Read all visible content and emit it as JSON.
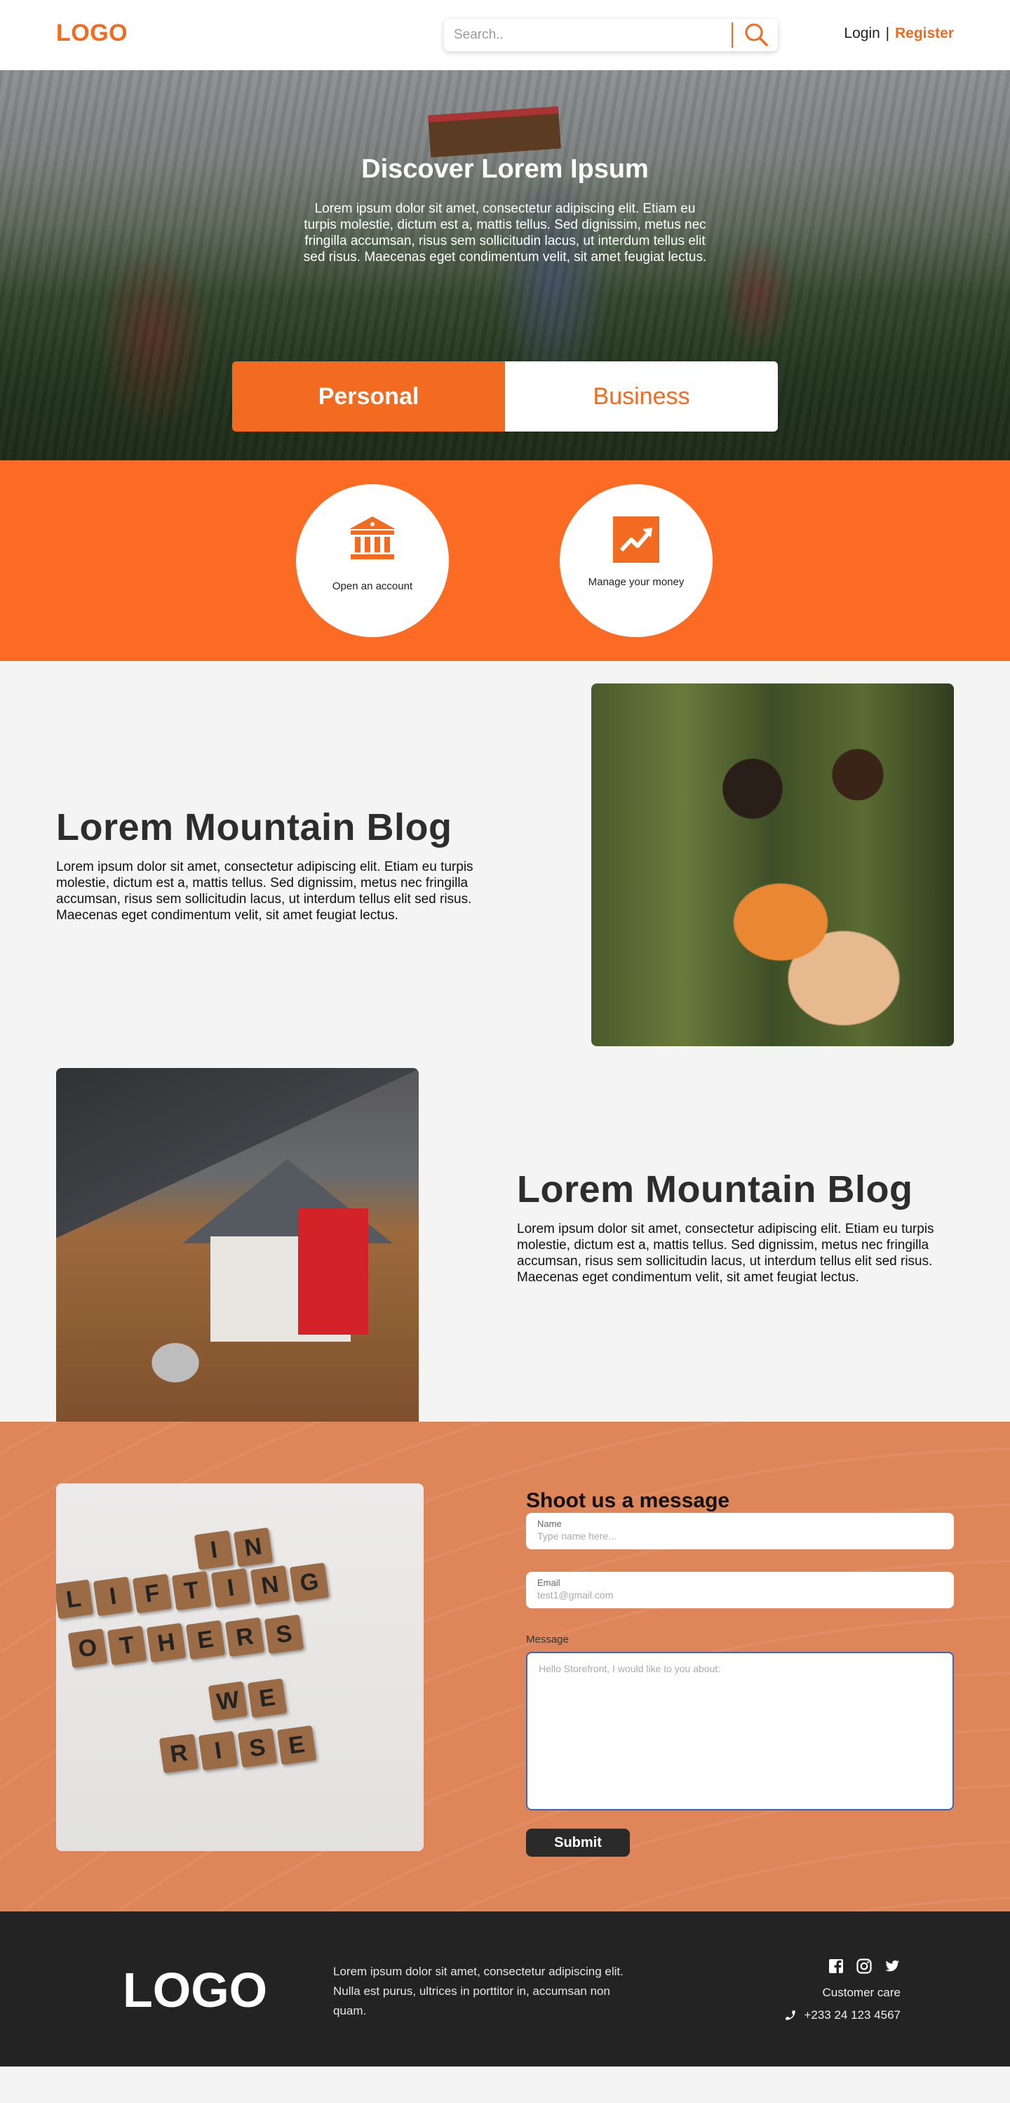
{
  "header": {
    "logo": "LOGO",
    "search_placeholder": "Search..",
    "login": "Login",
    "separator": "|",
    "register": "Register"
  },
  "hero": {
    "title": "Discover Lorem Ipsum",
    "text": "Lorem ipsum dolor sit amet, consectetur adipiscing elit. Etiam eu turpis molestie, dictum est a, mattis tellus. Sed dignissim, metus nec fringilla accumsan, risus sem sollicitudin lacus, ut interdum tellus elit sed risus. Maecenas eget condimentum velit, sit amet feugiat lectus.",
    "tabs": [
      {
        "label": "Personal",
        "active": true
      },
      {
        "label": "Business",
        "active": false
      }
    ]
  },
  "services": [
    {
      "icon": "bank-icon",
      "label": "Open an account"
    },
    {
      "icon": "trending-up-icon",
      "label": "Manage your money"
    }
  ],
  "blogs": [
    {
      "title": "Lorem Mountain Blog",
      "text": "Lorem ipsum dolor sit amet, consectetur adipiscing elit. Etiam eu turpis molestie, dictum est a, mattis tellus. Sed dignissim, metus nec fringilla accumsan, risus sem sollicitudin lacus, ut interdum tellus elit sed risus. Maecenas eget condimentum velit, sit amet feugiat lectus."
    },
    {
      "title": "Lorem Mountain Blog",
      "text": "Lorem ipsum dolor sit amet, consectetur adipiscing elit. Etiam eu turpis molestie, dictum est a, mattis tellus. Sed dignissim, metus nec fringilla accumsan, risus sem sollicitudin lacus, ut interdum tellus elit sed risus. Maecenas eget condimentum velit, sit amet feugiat lectus."
    }
  ],
  "contact": {
    "title": "Shoot us a message",
    "name_label": "Name",
    "name_placeholder": "Type name here...",
    "email_label": "Email",
    "email_placeholder": "test1@gmail.com",
    "message_label": "Message",
    "message_placeholder": "Hello Storefront, I would like to you about:",
    "submit": "Submit",
    "image_tiles": [
      [
        "I",
        "N"
      ],
      [
        "L",
        "I",
        "F",
        "T",
        "I",
        "N",
        "G"
      ],
      [
        "O",
        "T",
        "H",
        "E",
        "R",
        "S"
      ],
      [
        "W",
        "E"
      ],
      [
        "R",
        "I",
        "S",
        "E"
      ]
    ]
  },
  "footer": {
    "logo": "LOGO",
    "text": "Lorem ipsum dolor sit amet, consectetur adipiscing elit. Nulla est purus, ultrices in porttitor in, accumsan non quam.",
    "socials": [
      "facebook-icon",
      "instagram-icon",
      "twitter-icon"
    ],
    "customer_care": "Customer care",
    "phone": "+233 24 123 4567"
  },
  "colors": {
    "accent": "#f26b21",
    "services_bg": "#fb6b23",
    "contact_bg": "#df855a",
    "footer_bg": "#232323",
    "page_bg": "#f4f4f4"
  }
}
